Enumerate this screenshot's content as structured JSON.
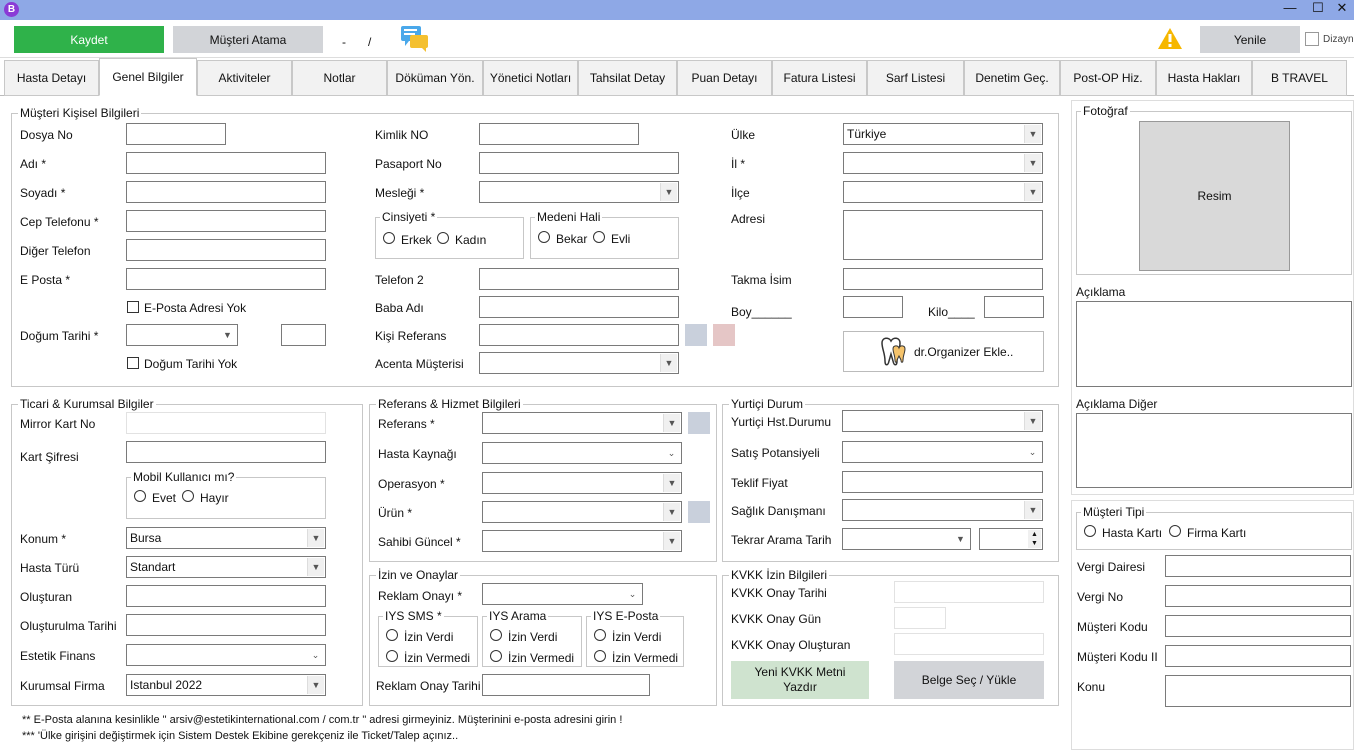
{
  "window": {
    "logo": "B",
    "minimize": "—",
    "maximize": "☐",
    "close": "✕"
  },
  "toolbar": {
    "save": "Kaydet",
    "assign": "Müşteri Atama",
    "dash": "-",
    "slash": "/",
    "refresh": "Yenile",
    "design": "Dizayn"
  },
  "tabs": [
    "Hasta Detayı",
    "Genel Bilgiler",
    "Aktiviteler",
    "Notlar",
    "Döküman Yön.",
    "Yönetici Notları",
    "Tahsilat Detay",
    "Puan Detayı",
    "Fatura Listesi",
    "Sarf Listesi",
    "Denetim Geç.",
    "Post-OP Hiz.",
    "Hasta Hakları",
    "B TRAVEL"
  ],
  "personal": {
    "title": "Müşteri Kişisel Bilgileri",
    "file_no": "Dosya No",
    "name": "Adı *",
    "surname": "Soyadı *",
    "mobile": "Cep Telefonu *",
    "other_phone": "Diğer Telefon",
    "email": "E Posta *",
    "no_email": "E-Posta Adresi Yok",
    "birth": "Doğum Tarihi *",
    "no_birth": "Doğum Tarihi Yok",
    "id_no": "Kimlik NO",
    "passport": "Pasaport No",
    "job": "Mesleği *",
    "gender": "Cinsiyeti  *",
    "male": "Erkek",
    "female": "Kadın",
    "marital": "Medeni Hali",
    "single": "Bekar",
    "married": "Evli",
    "phone2": "Telefon 2",
    "father": "Baba Adı",
    "ref_person": "Kişi Referans",
    "agency": "Acenta Müşterisi",
    "country": "Ülke",
    "country_val": "Türkiye",
    "city": "İl *",
    "district": "İlçe",
    "address": "Adresi",
    "nickname": "Takma İsim",
    "height": "Boy______",
    "weight": "Kilo____",
    "organizer": "dr.Organizer Ekle.."
  },
  "commercial": {
    "title": "Ticari & Kurumsal Bilgiler",
    "mirror": "Mirror Kart No",
    "card_pw": "Kart Şifresi",
    "mobile_user": "Mobil Kullanıcı mı?",
    "yes": "Evet",
    "no": "Hayır",
    "location": "Konum *",
    "location_val": "Bursa",
    "patient_type": "Hasta Türü",
    "patient_type_val": "Standart",
    "creator": "Oluşturan",
    "created_date": "Oluşturulma Tarihi",
    "finance": "Estetik Finans",
    "company": "Kurumsal Firma",
    "company_val": "Istanbul 2022"
  },
  "reference": {
    "title": "Referans  & Hizmet Bilgileri",
    "ref": "Referans *",
    "source": "Hasta Kaynağı",
    "operation": "Operasyon *",
    "product": "Ürün *",
    "owner": "Sahibi Güncel *"
  },
  "domestic": {
    "title": "Yurtiçi Durum",
    "status": "Yurtiçi Hst.Durumu",
    "potential": "Satış Potansiyeli",
    "offer": "Teklif Fiyat",
    "consultant": "Sağlık Danışmanı",
    "recall": "Tekrar Arama Tarih"
  },
  "consent": {
    "title": "İzin ve Onaylar",
    "ad": "Reklam Onayı *",
    "sms": "IYS SMS *",
    "call": "IYS Arama",
    "mail": "IYS E-Posta",
    "granted": "İzin Verdi",
    "denied": "İzin Vermedi",
    "ad_date": "Reklam Onay Tarihi"
  },
  "kvkk": {
    "title": "KVKK İzin Bilgileri",
    "date": "KVKK Onay Tarihi",
    "day": "KVKK Onay Gün",
    "creator": "KVKK Onay Oluşturan",
    "print": "Yeni KVKK Metni Yazdır",
    "upload": "Belge Seç / Yükle"
  },
  "side": {
    "photo": "Fotoğraf",
    "image": "Resim",
    "desc": "Açıklama",
    "desc2": "Açıklama Diğer",
    "cust_type": "Müşteri Tipi",
    "patient_card": "Hasta Kartı",
    "company_card": "Firma Kartı",
    "tax_office": "Vergi Dairesi",
    "tax_no": "Vergi No",
    "cust_code": "Müşteri Kodu",
    "cust_code2": "Müşteri Kodu II",
    "subject": "Konu"
  },
  "notes": [
    "** E-Posta alanına kesinlikle \" arsiv@estetikinternational.com / com.tr \" adresi girmeyiniz. Müşterinini e-posta adresini girin !",
    "*** 'Ülke girişini değiştirmek için Sistem Destek Ekibine gerekçeniz ile Ticket/Talep açınız.."
  ],
  "colors": {
    "accent_green": "#2fb24a",
    "titlebar": "#8ea8e6",
    "button_gray": "#d2d4d8",
    "kvkk_green": "#cfe3cf"
  }
}
